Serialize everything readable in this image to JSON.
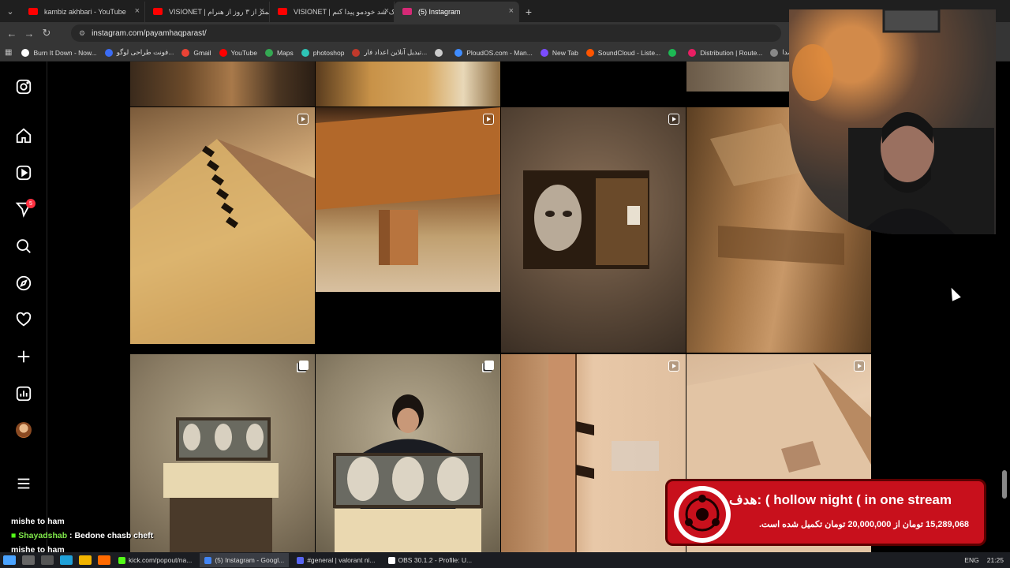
{
  "browser": {
    "tabs": [
      {
        "title": "kambiz akhbari - YouTube",
        "favicon_color": "#ff0000",
        "active": false
      },
      {
        "title": "VISIONET | کمتر از ۳ روز از هنرام",
        "favicon_color": "#ff0000",
        "active": false
      },
      {
        "title": "VISIONET | یک شد خودمو پیدا کنم",
        "favicon_color": "#ff0000",
        "active": false
      },
      {
        "title": "(5) Instagram",
        "favicon_color": "#d62976",
        "active": true
      }
    ],
    "new_tab_label": "+",
    "close_glyph": "×",
    "url": "instagram.com/payamhaqparast/",
    "bookmarks": [
      {
        "label": "Burn It Down - Now...",
        "color": "#ffffff"
      },
      {
        "label": "فونت طراحی لوگو...",
        "color": "#3b6cf5"
      },
      {
        "label": "Gmail",
        "color": "#ea4335"
      },
      {
        "label": "YouTube",
        "color": "#ff0000"
      },
      {
        "label": "Maps",
        "color": "#34a853"
      },
      {
        "label": "photoshop",
        "color": "#2ec4b6"
      },
      {
        "label": "تبدیل آنلاین اعداد فار...",
        "color": "#c0392b"
      },
      {
        "label": "",
        "color": "#cccccc"
      },
      {
        "label": "PloudOS.com - Man...",
        "color": "#3f8cff"
      },
      {
        "label": "New Tab",
        "color": "#7b4cff"
      },
      {
        "label": "SoundCloud - Liste...",
        "color": "#ff5500"
      },
      {
        "label": "",
        "color": "#1db954"
      },
      {
        "label": "Distribution | Route...",
        "color": "#e91e63"
      },
      {
        "label": "صدا...",
        "color": "#888888"
      }
    ]
  },
  "instagram": {
    "notification_count": "5",
    "nav": [
      "instagram-logo-icon",
      "home-icon",
      "reels-icon",
      "messages-icon",
      "search-icon",
      "explore-icon",
      "notifications-icon",
      "create-icon",
      "dashboard-icon",
      "profile-avatar",
      "menu-icon"
    ],
    "posts": [
      {
        "kind": "none",
        "desc": "workshop top"
      },
      {
        "kind": "none",
        "desc": "cabinet top"
      },
      {
        "kind": "none",
        "desc": "black"
      },
      {
        "kind": "none",
        "desc": "stone"
      },
      {
        "kind": "video",
        "desc": "dovetail joint"
      },
      {
        "kind": "video",
        "desc": "wooden stool leg"
      },
      {
        "kind": "video",
        "desc": "mask in box"
      },
      {
        "kind": "video",
        "desc": "wood grain"
      },
      {
        "kind": "carousel",
        "desc": "three masks display"
      },
      {
        "kind": "carousel",
        "desc": "woman with masks"
      },
      {
        "kind": "video",
        "desc": "dovetail boards"
      },
      {
        "kind": "video",
        "desc": "drawer corner"
      }
    ]
  },
  "donation": {
    "title": "هدف: ( hollow night ( in one stream",
    "progress_text": "15,289,068 تومان از 20,000,000 تومان تکمیل شده است.",
    "raised": 15289068,
    "goal": 20000000
  },
  "chat": [
    {
      "user": "",
      "text": "mishe to ham"
    },
    {
      "user": "Shayadshab",
      "text": ": Bedone chasb cheft"
    },
    {
      "user": "",
      "text": "mishe to ham"
    }
  ],
  "taskbar": {
    "apps": [
      {
        "label": "kick.com/popout/na...",
        "color": "#53fc18",
        "active": false
      },
      {
        "label": "(5) Instagram - Googl...",
        "color": "#4285f4",
        "active": true
      },
      {
        "label": "#general | valorant ni...",
        "color": "#5865f2",
        "active": false
      },
      {
        "label": "OBS 30.1.2 - Profile: U...",
        "color": "#ffffff",
        "active": false
      }
    ],
    "language": "ENG",
    "time": "21:25"
  }
}
